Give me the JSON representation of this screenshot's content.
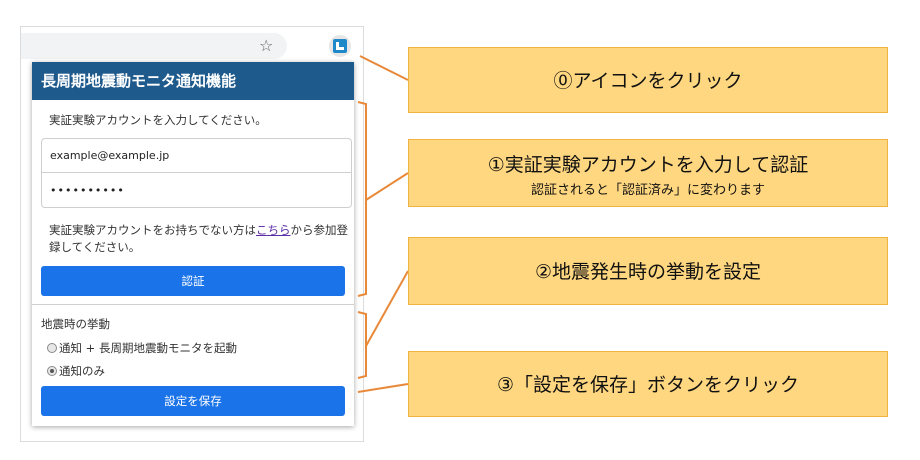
{
  "browser": {
    "star_icon": "star-icon",
    "extension_icon": "extension-icon"
  },
  "popup": {
    "title": "長周期地震動モニタ通知機能",
    "auth": {
      "description": "実証実験アカウントを入力してください。",
      "email_value": "example@example.jp",
      "password_value": "••••••••••",
      "signup_prefix": "実証実験アカウントをお持ちでない方は",
      "signup_link": "こちら",
      "signup_suffix": "から参加登録してください。",
      "button_label": "認証"
    },
    "behavior": {
      "title": "地震時の挙動",
      "options": [
        {
          "label": "通知 + 長周期地震動モニタを起動",
          "selected": false
        },
        {
          "label": "通知のみ",
          "selected": true
        }
      ],
      "save_label": "設定を保存"
    }
  },
  "callouts": [
    {
      "main": "⓪アイコンをクリック",
      "sub": ""
    },
    {
      "main": "①実証実験アカウントを入力して認証",
      "sub": "認証されると「認証済み」に変わります"
    },
    {
      "main": "②地震発生時の挙動を設定",
      "sub": ""
    },
    {
      "main": "③「設定を保存」ボタンをクリック",
      "sub": ""
    }
  ],
  "colors": {
    "header_bg": "#1f5a8c",
    "button_bg": "#1a73e8",
    "callout_bg": "#ffd780",
    "callout_border": "#f0b340",
    "connector": "#e8893a"
  }
}
